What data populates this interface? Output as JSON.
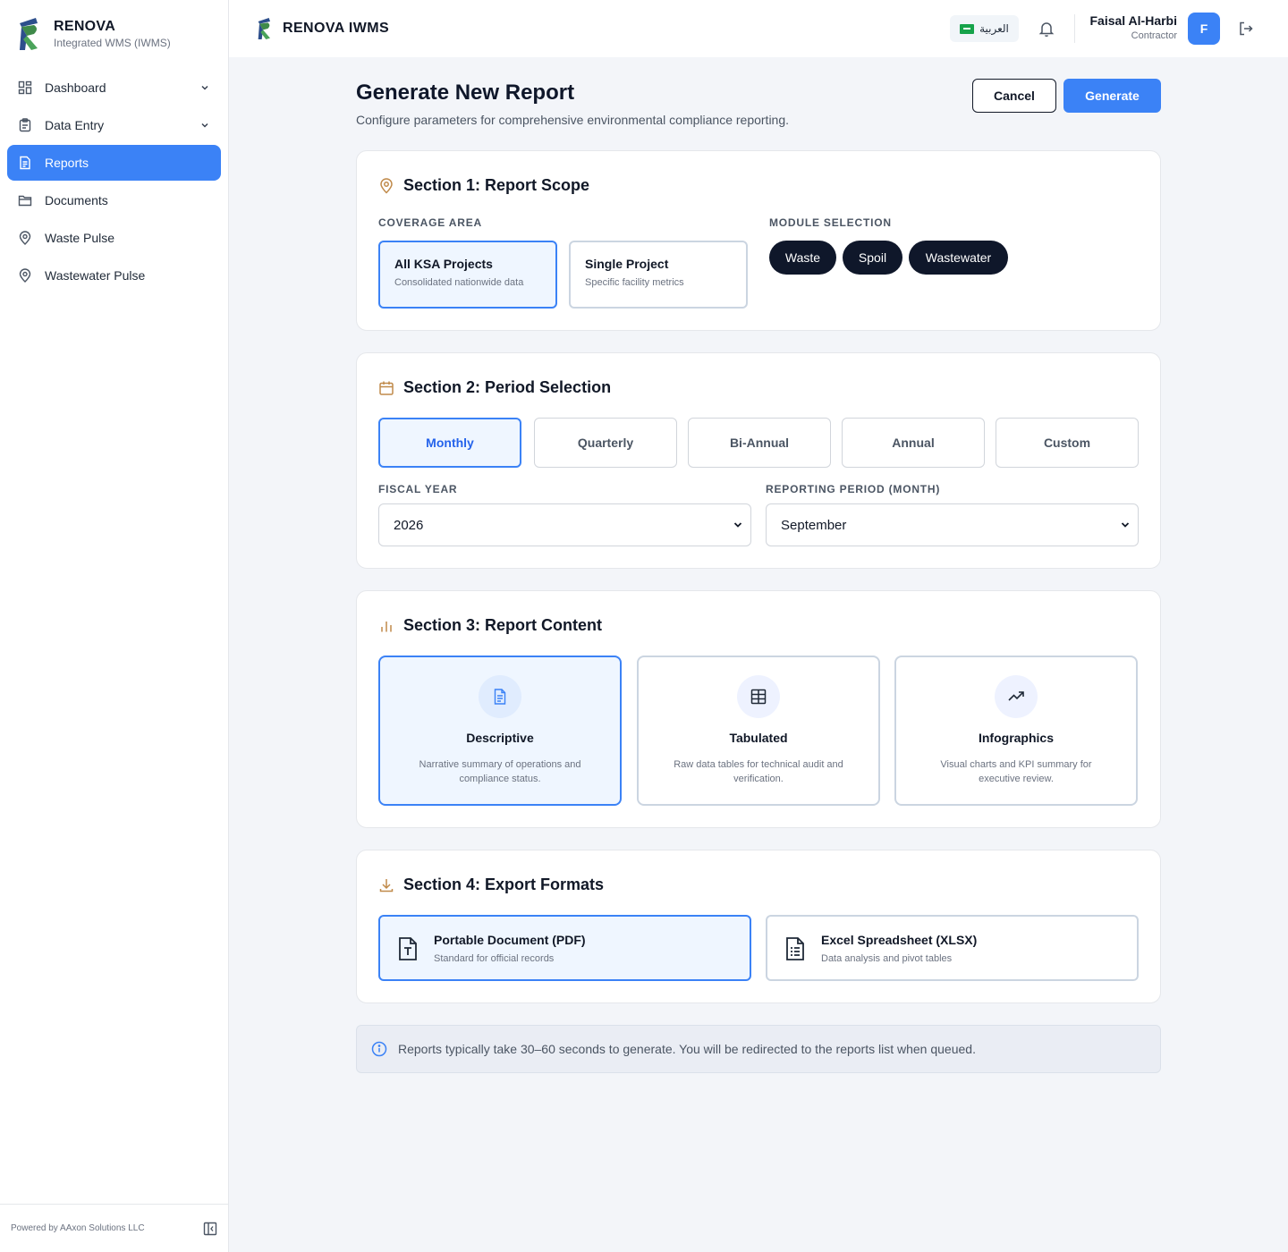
{
  "app": {
    "brand_name": "RENOVA",
    "brand_sub": "Integrated WMS (IWMS)",
    "header_brand": "RENOVA IWMS"
  },
  "sidebar": {
    "items": [
      {
        "label": "Dashboard",
        "icon": "dashboard-icon",
        "has_chevron": true
      },
      {
        "label": "Data Entry",
        "icon": "clipboard-icon",
        "has_chevron": true
      },
      {
        "label": "Reports",
        "icon": "file-text-icon",
        "active": true
      },
      {
        "label": "Documents",
        "icon": "folder-icon"
      },
      {
        "label": "Waste Pulse",
        "icon": "map-pin-icon"
      },
      {
        "label": "Wastewater Pulse",
        "icon": "map-pin-icon"
      }
    ],
    "footer": "Powered by AAxon Solutions LLC"
  },
  "header": {
    "language": "العربية",
    "user_name": "Faisal Al-Harbi",
    "user_role": "Contractor",
    "avatar_initial": "F"
  },
  "page": {
    "title": "Generate New Report",
    "subtitle": "Configure parameters for comprehensive environmental compliance reporting.",
    "cancel_label": "Cancel",
    "generate_label": "Generate"
  },
  "section1": {
    "title": "Section 1: Report Scope",
    "coverage_label": "COVERAGE AREA",
    "module_label": "MODULE SELECTION",
    "coverage": [
      {
        "title": "All KSA Projects",
        "desc": "Consolidated nationwide data",
        "selected": true
      },
      {
        "title": "Single Project",
        "desc": "Specific facility metrics",
        "selected": false
      }
    ],
    "modules": [
      "Waste",
      "Spoil",
      "Wastewater"
    ]
  },
  "section2": {
    "title": "Section 2: Period Selection",
    "periods": [
      "Monthly",
      "Quarterly",
      "Bi-Annual",
      "Annual",
      "Custom"
    ],
    "selected_period": "Monthly",
    "fiscal_year_label": "FISCAL YEAR",
    "fiscal_year_value": "2026",
    "month_label": "REPORTING PERIOD (MONTH)",
    "month_value": "September"
  },
  "section3": {
    "title": "Section 3: Report Content",
    "options": [
      {
        "title": "Descriptive",
        "desc": "Narrative summary of operations and compliance status.",
        "icon": "document-icon",
        "selected": true
      },
      {
        "title": "Tabulated",
        "desc": "Raw data tables for technical audit and verification.",
        "icon": "table-icon",
        "selected": false
      },
      {
        "title": "Infographics",
        "desc": "Visual charts and KPI summary for executive review.",
        "icon": "trending-up-icon",
        "selected": false
      }
    ]
  },
  "section4": {
    "title": "Section 4: Export Formats",
    "formats": [
      {
        "title": "Portable Document (PDF)",
        "desc": "Standard for official records",
        "icon": "pdf-file-icon",
        "selected": true
      },
      {
        "title": "Excel Spreadsheet (XLSX)",
        "desc": "Data analysis and pivot tables",
        "icon": "spreadsheet-file-icon",
        "selected": false
      }
    ]
  },
  "notice": {
    "text": "Reports typically take 30–60 seconds to generate. You will be redirected to the reports list when queued."
  },
  "colors": {
    "accent": "#3b82f6",
    "dark_pill": "#0f172a",
    "section_icon": "#c08a4a",
    "selected_bg": "#eff6ff"
  }
}
